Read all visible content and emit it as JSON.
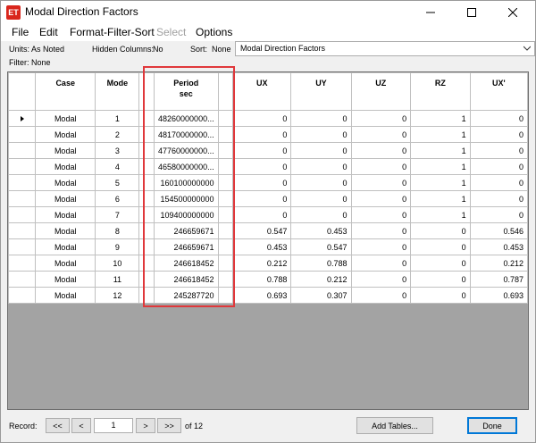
{
  "window": {
    "app_icon_text": "ET",
    "title": "Modal Direction Factors"
  },
  "menu": {
    "file": "File",
    "edit": "Edit",
    "format": "Format-Filter-Sort",
    "select": "Select",
    "options": "Options"
  },
  "info": {
    "units_label": "Units:",
    "units_value": "As Noted",
    "hidden_label": "Hidden Columns:",
    "hidden_value": "No",
    "sort_label": "Sort:",
    "sort_value": "None",
    "filter_label": "Filter:",
    "filter_value": "None",
    "table_select": "Modal Direction Factors"
  },
  "columns": {
    "case": "Case",
    "mode": "Mode",
    "period": "Period",
    "period_unit": "sec",
    "ux": "UX",
    "uy": "UY",
    "uz": "UZ",
    "rz": "RZ",
    "ux2": "UX'"
  },
  "rows": [
    {
      "case": "Modal",
      "mode": "1",
      "period": "48260000000...",
      "ux": "0",
      "uy": "0",
      "uz": "0",
      "rz": "1",
      "ux2": "0"
    },
    {
      "case": "Modal",
      "mode": "2",
      "period": "48170000000...",
      "ux": "0",
      "uy": "0",
      "uz": "0",
      "rz": "1",
      "ux2": "0"
    },
    {
      "case": "Modal",
      "mode": "3",
      "period": "47760000000...",
      "ux": "0",
      "uy": "0",
      "uz": "0",
      "rz": "1",
      "ux2": "0"
    },
    {
      "case": "Modal",
      "mode": "4",
      "period": "46580000000...",
      "ux": "0",
      "uy": "0",
      "uz": "0",
      "rz": "1",
      "ux2": "0"
    },
    {
      "case": "Modal",
      "mode": "5",
      "period": "160100000000",
      "ux": "0",
      "uy": "0",
      "uz": "0",
      "rz": "1",
      "ux2": "0"
    },
    {
      "case": "Modal",
      "mode": "6",
      "period": "154500000000",
      "ux": "0",
      "uy": "0",
      "uz": "0",
      "rz": "1",
      "ux2": "0"
    },
    {
      "case": "Modal",
      "mode": "7",
      "period": "109400000000",
      "ux": "0",
      "uy": "0",
      "uz": "0",
      "rz": "1",
      "ux2": "0"
    },
    {
      "case": "Modal",
      "mode": "8",
      "period": "246659671",
      "ux": "0.547",
      "uy": "0.453",
      "uz": "0",
      "rz": "0",
      "ux2": "0.546"
    },
    {
      "case": "Modal",
      "mode": "9",
      "period": "246659671",
      "ux": "0.453",
      "uy": "0.547",
      "uz": "0",
      "rz": "0",
      "ux2": "0.453"
    },
    {
      "case": "Modal",
      "mode": "10",
      "period": "246618452",
      "ux": "0.212",
      "uy": "0.788",
      "uz": "0",
      "rz": "0",
      "ux2": "0.212"
    },
    {
      "case": "Modal",
      "mode": "11",
      "period": "246618452",
      "ux": "0.788",
      "uy": "0.212",
      "uz": "0",
      "rz": "0",
      "ux2": "0.787"
    },
    {
      "case": "Modal",
      "mode": "12",
      "period": "245287720",
      "ux": "0.693",
      "uy": "0.307",
      "uz": "0",
      "rz": "0",
      "ux2": "0.693"
    }
  ],
  "nav": {
    "record_label": "Record:",
    "first": "<<",
    "prev": "<",
    "record_value": "1",
    "next": ">",
    "last": ">>",
    "of_total": "of 12",
    "add_tables": "Add Tables...",
    "done": "Done"
  },
  "colors": {
    "highlight": "#e0383b",
    "grid_background": "#a3a3a3"
  }
}
